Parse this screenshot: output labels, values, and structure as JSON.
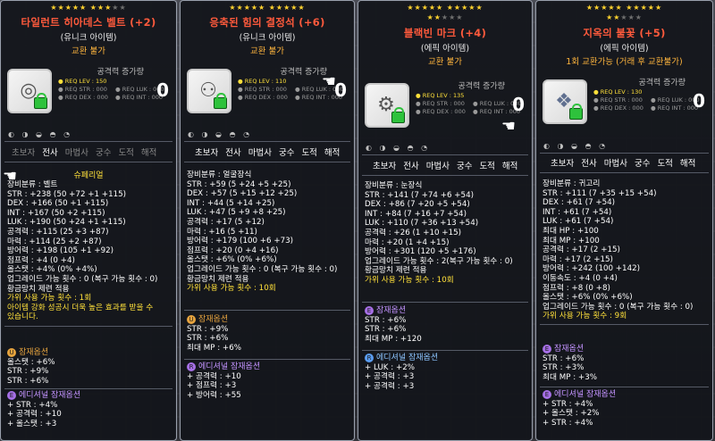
{
  "tooltips": [
    {
      "stars": "★★★★★★★★★★",
      "stars_on": 8,
      "name": "타일런트 히아데스 벨트 (+2)",
      "rarity": "(유니크 아이템)",
      "trade": "교환 불가",
      "attack_label": "공격력 증가량",
      "attack_value": "0",
      "req_level": "● REQ LEV : 150",
      "req_str": "● REQ STR : 000",
      "req_dex": "● REQ DEX : 000",
      "req_luk": "● REQ LUK : 000",
      "req_int": "● REQ INT : 000",
      "jobs": [
        "초보자",
        "전사",
        "마법사",
        "궁수",
        "도적",
        "해적"
      ],
      "active_jobs": [
        false,
        true,
        true,
        true,
        true,
        true
      ],
      "category_extra": "슈페리얼",
      "stats": [
        "장비분류 : 벨트",
        "STR : +238 (50 +72 +1 +115)",
        "DEX : +166 (50 +1 +115)",
        "INT : +167 (50 +2 +115)",
        "LUK : +190 (50 +24 +1 +115)",
        "공격력 : +115 (25 +3 +87)",
        "마력 : +114 (25 +2 +87)",
        "방어력 : +198 (105 +1 +92)",
        "점프력 : +4 (0 +4)",
        "올스탯 : +4% (0% +4%)",
        "업그레이드 가능 횟수 : 0 (복구 가능 횟수 : 0)",
        "황금망치 제련 적용",
        "가위 사용 가능 횟수 : 1회",
        "아이템 강화 성공시 더욱 높은 효과를 받을 수",
        "있습니다."
      ],
      "potential_label": "잠재옵션",
      "potential": [
        "올스탯 : +6%",
        "STR : +9%",
        "STR : +6%"
      ],
      "add_potential_label": "에디셔널 잠재옵션",
      "add_potential": [
        "+ STR : +4%",
        "+ 공격력 : +10",
        "+ 올스탯 : +3"
      ]
    },
    {
      "stars": "★★★★★★★★★★",
      "stars_on": 10,
      "name": "응축된 힘의 결정석 (+6)",
      "rarity": "(유니크 아이템)",
      "trade": "교환 불가",
      "attack_label": "공격력 증가량",
      "attack_value": "0",
      "req_level": "● REQ LEV : 110",
      "req_str": "● REQ STR : 000",
      "req_dex": "● REQ DEX : 000",
      "req_luk": "● REQ LUK : 000",
      "req_int": "● REQ INT : 000",
      "jobs": [
        "초보자",
        "전사",
        "마법사",
        "궁수",
        "도적",
        "해적"
      ],
      "active_jobs": [
        true,
        true,
        true,
        true,
        true,
        true
      ],
      "stats": [
        "장비분류 : 얼굴장식",
        "STR : +59 (5 +24 +5 +25)",
        "DEX : +57 (5 +15 +12 +25)",
        "INT : +44 (5 +14 +25)",
        "LUK : +47 (5 +9 +8 +25)",
        "공격력 : +17 (5 +12)",
        "마력 : +16 (5 +11)",
        "방어력 : +179 (100 +6 +73)",
        "점프력 : +20 (0 +4 +16)",
        "올스탯 : +6% (0% +6%)",
        "업그레이드 가능 횟수 : 0 (복구 가능 횟수 : 0)",
        "황금망치 제련 적용",
        "가위 사용 가능 횟수 : 10회"
      ],
      "potential_label": "잠재옵션",
      "potential": [
        "STR : +9%",
        "STR : +6%",
        "최대 MP : +6%"
      ],
      "add_potential_label": "에디셔널 잠재옵션",
      "add_potential": [
        "+ 공격력 : +10",
        "+ 점프력 : +3",
        "+ 방어력 : +55"
      ]
    },
    {
      "stars": "★★★★★★★★★★",
      "stars_on": 10,
      "stars2": "★★★★★",
      "stars2_on": 2,
      "name": "블랙빈 마크 (+4)",
      "rarity": "(에픽 아이템)",
      "trade": "교환 불가",
      "attack_label": "공격력 증가량",
      "attack_value": "0",
      "req_level": "● REQ LEV : 135",
      "req_str": "● REQ STR : 000",
      "req_dex": "● REQ DEX : 000",
      "req_luk": "● REQ LUK : 000",
      "req_int": "● REQ INT : 000",
      "jobs": [
        "초보자",
        "전사",
        "마법사",
        "궁수",
        "도적",
        "해적"
      ],
      "active_jobs": [
        true,
        true,
        true,
        true,
        true,
        true
      ],
      "stats": [
        "장비분류 : 눈장식",
        "STR : +141 (7 +74 +6 +54)",
        "DEX : +86 (7 +20 +5 +54)",
        "INT : +84 (7 +16 +7 +54)",
        "LUK : +110 (7 +36 +13 +54)",
        "공격력 : +26 (1 +10 +15)",
        "마력 : +20 (1 +4 +15)",
        "방어력 : +301 (120 +5 +176)",
        "업그레이드 가능 횟수 : 2(복구 가능 횟수 : 0)",
        "황금망치 제련 적용",
        "가위 사용 가능 횟수 : 10회"
      ],
      "potential_label": "잠재옵션",
      "potential": [
        "STR : +6%",
        "STR : +6%",
        "최대 MP : +120"
      ],
      "add_potential_label": "에디셔널 잠재옵션",
      "add_potential": [
        "+ LUK : +2%",
        "+ 공격력 : +3",
        "+ 공격력 : +3"
      ]
    },
    {
      "stars": "★★★★★★★★★★",
      "stars_on": 10,
      "stars2": "★★★★★",
      "stars2_on": 2,
      "name": "지옥의 불꽃 (+5)",
      "rarity": "(에픽 아이템)",
      "trade": "1회 교환가능 (거래 후 교환불가)",
      "attack_label": "공격력 증가량",
      "attack_value": "0",
      "req_level": "● REQ LEV : 130",
      "req_str": "● REQ STR : 000",
      "req_dex": "● REQ DEX : 000",
      "req_luk": "● REQ LUK : 000",
      "req_int": "● REQ INT : 000",
      "jobs": [
        "초보자",
        "전사",
        "마법사",
        "궁수",
        "도적",
        "해적"
      ],
      "active_jobs": [
        true,
        true,
        true,
        true,
        true,
        true
      ],
      "stats": [
        "장비분류 : 귀고리",
        "STR : +111 (7 +35 +15 +54)",
        "DEX : +61 (7 +54)",
        "INT : +61 (7 +54)",
        "LUK : +61 (7 +54)",
        "최대 HP : +100",
        "최대 MP : +100",
        "공격력 : +17 (2 +15)",
        "마력 : +17 (2 +15)",
        "방어력 : +242 (100 +142)",
        "이동속도 : +4 (0 +4)",
        "점프력 : +8 (0 +8)",
        "올스탯 : +6% (0% +6%)",
        "업그레이드 가능 횟수 : 0 (복구 가능 횟수 : 0)",
        "가위 사용 가능 횟수 : 9회"
      ],
      "potential_label": "잠재옵션",
      "potential": [
        "STR : +6%",
        "STR : +3%",
        "최대 MP : +3%"
      ],
      "add_potential_label": "에디셔널 잠재옵션",
      "add_potential": [
        "+ STR : +4%",
        "+ 올스탯 : +2%",
        "+ STR : +4%"
      ]
    }
  ]
}
